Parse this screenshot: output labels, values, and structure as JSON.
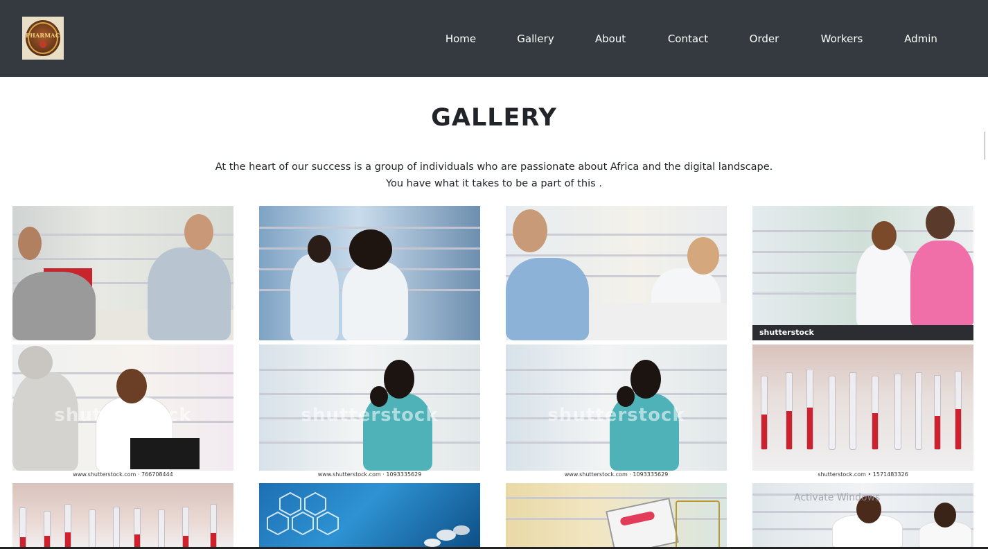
{
  "brand": {
    "logo_text": "PHARMACY"
  },
  "nav": {
    "items": [
      {
        "label": "Home"
      },
      {
        "label": "Gallery"
      },
      {
        "label": "About"
      },
      {
        "label": "Contact"
      },
      {
        "label": "Order"
      },
      {
        "label": "Workers"
      },
      {
        "label": "Admin"
      }
    ]
  },
  "page": {
    "title": "GALLERY",
    "intro_line1": "At the heart of our success is a group of individuals who are passionate about Africa and the digital landscape.",
    "intro_line2": "You have what it takes to be a part of this ."
  },
  "gallery": {
    "tiles": [
      {
        "subject": "pharmacist-at-counter"
      },
      {
        "subject": "pharmacists-checking-shelves"
      },
      {
        "subject": "pharmacist-handing-prescription"
      },
      {
        "subject": "pharmacist-with-customer",
        "bar_text": "shutterstock"
      },
      {
        "subject": "pharmacist-serving-customer",
        "watermark": "shutterstock",
        "caption": "www.shutterstock.com · 766708444"
      },
      {
        "subject": "pharmacist-stocking-shelf",
        "watermark": "shutterstock",
        "caption": "www.shutterstock.com · 1093335629"
      },
      {
        "subject": "pharmacist-stocking-shelf",
        "watermark": "shutterstock",
        "caption": "www.shutterstock.com · 1093335629"
      },
      {
        "subject": "medicine-ampoules",
        "caption": "shutterstock.com • 1571483326"
      },
      {
        "subject": "medicine-ampoules"
      },
      {
        "subject": "medical-icons-and-pills"
      },
      {
        "subject": "pharmacy-shopping-cart"
      },
      {
        "subject": "pharmacists-at-shelves"
      }
    ]
  },
  "system_overlay": {
    "text": "Activate Windows"
  }
}
